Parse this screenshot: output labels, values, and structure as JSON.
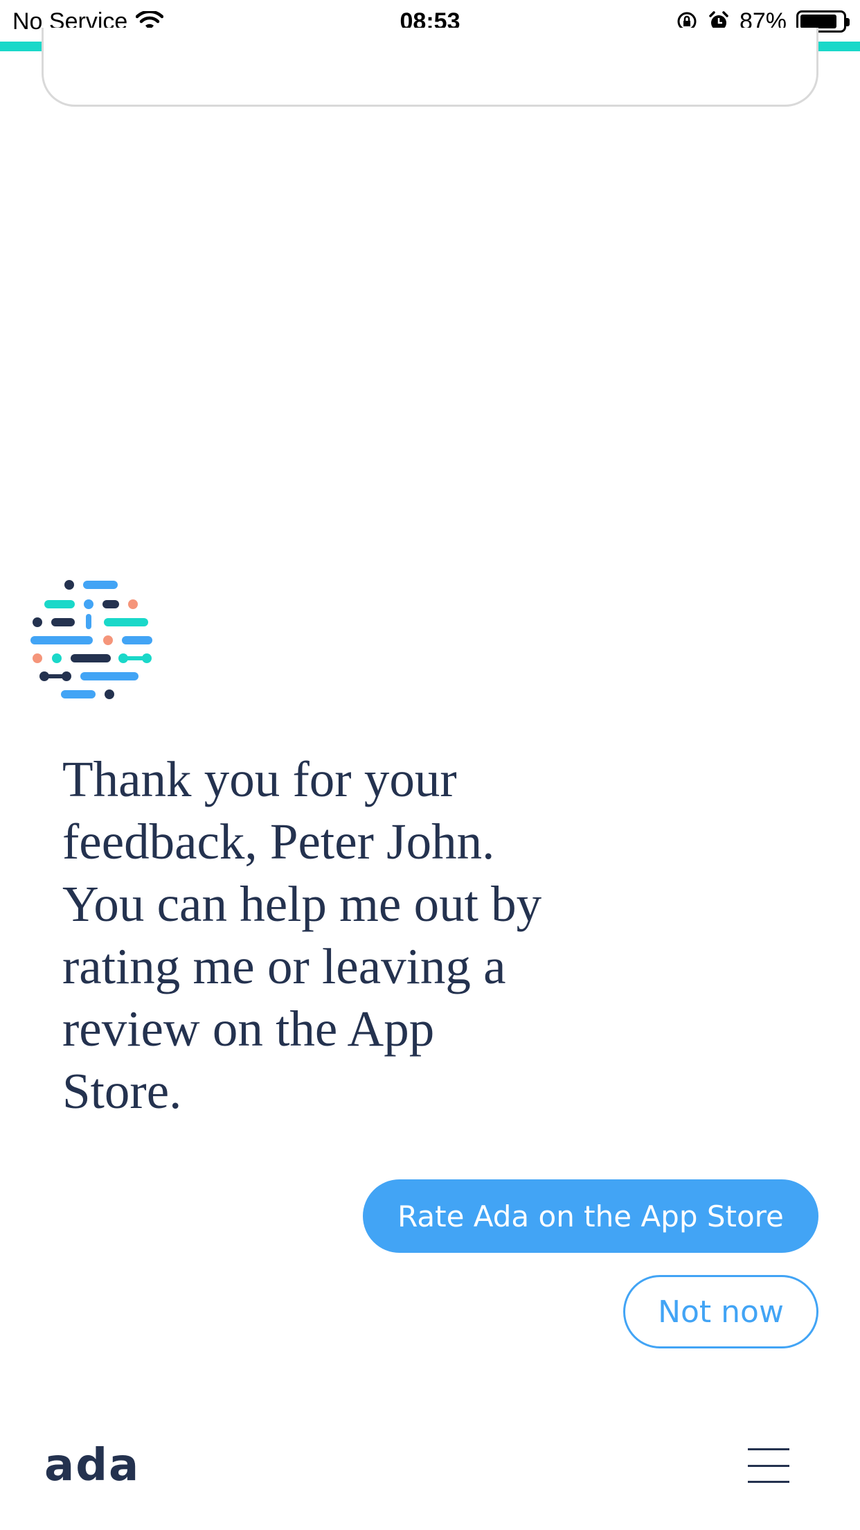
{
  "status_bar": {
    "carrier": "No Service",
    "time": "08:53",
    "battery_percent": "87%",
    "battery_level": 0.87,
    "icons": [
      "wifi-icon",
      "orientation-lock-icon",
      "alarm-icon",
      "battery-icon"
    ]
  },
  "progress": {
    "color": "#1ad8c9"
  },
  "chat": {
    "message": "Thank you for your feedback, Peter John. You can help me out by rating me or leaving a review on the App Store.",
    "message_lines": [
      "Thank you for your",
      "feedback, Peter John.",
      "You can help me out by",
      "rating me or leaving a",
      "review on the App",
      "Store."
    ]
  },
  "actions": {
    "rate_label": "Rate Ada on the App Store",
    "not_now_label": "Not now"
  },
  "footer": {
    "logo_text": "ada",
    "menu_icon": "hamburger-menu-icon"
  },
  "colors": {
    "primary": "#42a4f5",
    "teal": "#1ad8c9",
    "navy": "#24324f",
    "coral": "#f5957a"
  }
}
